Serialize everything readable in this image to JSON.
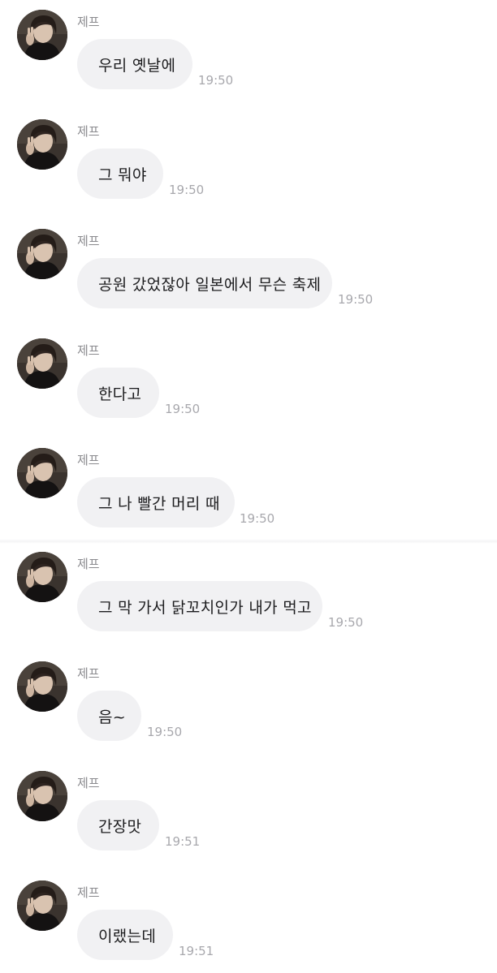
{
  "messages": [
    {
      "sender": "제프",
      "text": "우리 옛날에",
      "time": "19:50"
    },
    {
      "sender": "제프",
      "text": "그 뭐야",
      "time": "19:50"
    },
    {
      "sender": "제프",
      "text": "공원 갔었잖아 일본에서 무슨 축제",
      "time": "19:50"
    },
    {
      "sender": "제프",
      "text": "한다고",
      "time": "19:50"
    },
    {
      "sender": "제프",
      "text": "그 나 빨간 머리 때",
      "time": "19:50"
    },
    {
      "sender": "제프",
      "text": "그 막 가서 닭꼬치인가 내가 먹고",
      "time": "19:50"
    },
    {
      "sender": "제프",
      "text": "음~",
      "time": "19:50"
    },
    {
      "sender": "제프",
      "text": "간장맛",
      "time": "19:51"
    },
    {
      "sender": "제프",
      "text": "이랬는데",
      "time": "19:51"
    }
  ],
  "colors": {
    "bubble": "#f1f1f3",
    "name": "#8a8a8e",
    "time": "#a8a8ad",
    "text": "#1c1c1e"
  },
  "icons": {
    "avatar": "profile-photo"
  }
}
